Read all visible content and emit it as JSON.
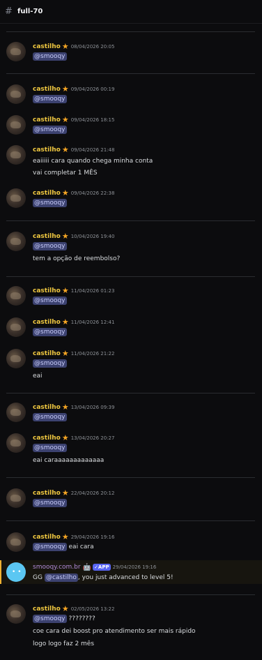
{
  "channel": {
    "icon": "hash-thread-icon",
    "name": "full-70"
  },
  "user": {
    "name": "castilho",
    "badge": "star-icon"
  },
  "mention_smooqy": "@smooqy",
  "messages": [
    {
      "time": "08/04/2026 20:05",
      "lines": []
    },
    {
      "time": "09/04/2026 00:19",
      "lines": []
    },
    {
      "time": "09/04/2026 18:15",
      "lines": []
    },
    {
      "time": "09/04/2026 21:48",
      "lines": [
        "eaiiiii cara quando chega minha conta",
        "vai completar 1 MÊS"
      ]
    },
    {
      "time": "09/04/2026 22:38",
      "lines": []
    },
    {
      "time": "10/04/2026 19:40",
      "lines": [
        "tem a opção de reembolso?"
      ]
    },
    {
      "time": "11/04/2026 01:23",
      "lines": []
    },
    {
      "time": "11/04/2026 12:41",
      "lines": []
    },
    {
      "time": "11/04/2026 21:22",
      "lines": [
        "eai"
      ]
    },
    {
      "time": "13/04/2026 09:39",
      "lines": []
    },
    {
      "time": "13/04/2026 20:27",
      "lines": [
        "eai caraaaaaaaaaaaaa"
      ]
    },
    {
      "time": "22/04/2026 20:12",
      "lines": []
    },
    {
      "time": "29/04/2026 19:16",
      "inline": "eai cara",
      "lines": []
    },
    {
      "time": "02/05/2026 13:22",
      "inline": "????????",
      "lines": [
        "coe cara dei boost pro atendimento ser mais rápido",
        "logo logo faz 2 mês"
      ]
    }
  ],
  "bot_message": {
    "name": "smooqy.com.br",
    "robot_icon": "robot-icon",
    "app_badge": "✓APP",
    "time": "29/04/2026 19:16",
    "text_before": "GG",
    "mention": "@castilho",
    "text_after": ", you just advanced to level 5!"
  },
  "colors": {
    "username": "#f0c840",
    "mention_bg": "#3c4270",
    "mention_text": "#c9cdfb",
    "highlight_bar": "#f0b232"
  }
}
